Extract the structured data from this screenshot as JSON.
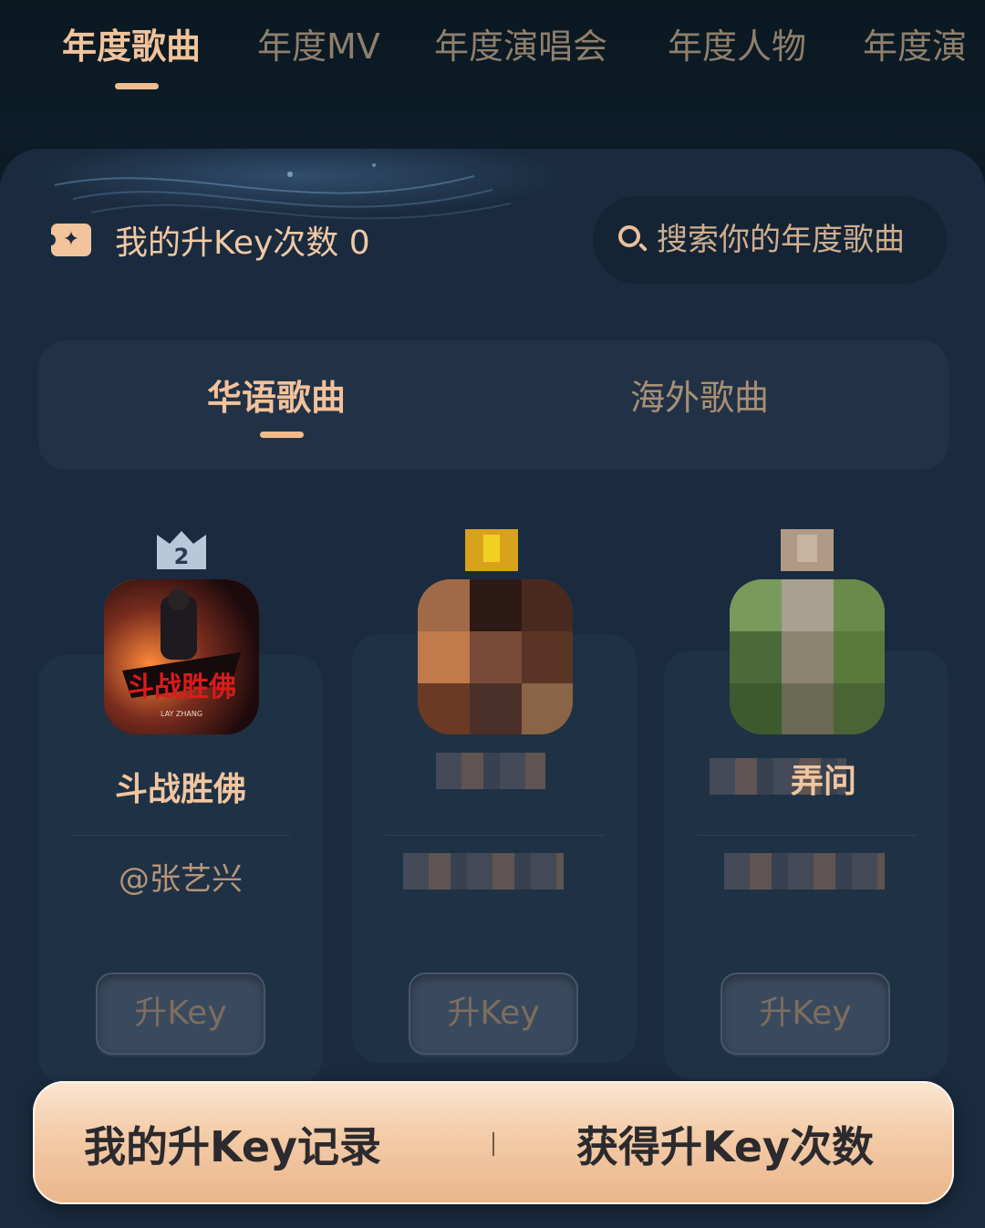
{
  "top_tabs": [
    "年度歌曲",
    "年度MV",
    "年度演唱会",
    "年度人物",
    "年度演"
  ],
  "key_count": {
    "label": "我的升Key次数",
    "value": "0"
  },
  "search": {
    "placeholder": "搜索你的年度歌曲"
  },
  "sub_tabs": [
    "华语歌曲",
    "海外歌曲"
  ],
  "songs": [
    {
      "rank": "2",
      "title": "斗战胜佛",
      "artist": "@张艺兴",
      "button": "升Key",
      "cover_text": "斗战胜佛",
      "cover_subtext": "LAY ZHANG"
    },
    {
      "rank": "",
      "title": "",
      "artist": "",
      "button": "升Key"
    },
    {
      "rank": "",
      "title": "弄问",
      "artist": "",
      "button": "升Key"
    }
  ],
  "bottom_bar": {
    "left": "我的升Key记录",
    "right": "获得升Key次数"
  },
  "colors": {
    "accent": "#f0bd92",
    "background": "#0c1b26",
    "panel": "#1a2b3f"
  }
}
